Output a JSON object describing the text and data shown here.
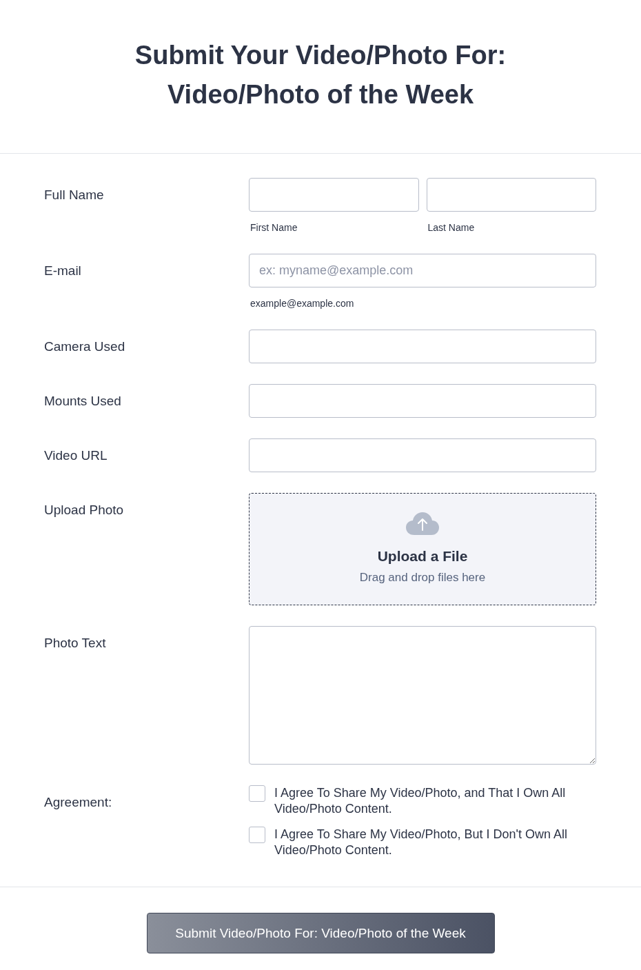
{
  "title": "Submit Your Video/Photo For: Video/Photo of the Week",
  "fields": [
    {
      "kind": "name",
      "label": "Full Name",
      "sublabels": [
        "First Name",
        "Last Name"
      ]
    },
    {
      "kind": "email",
      "label": "E-mail",
      "placeholder": "ex: myname@example.com",
      "sublabel": "example@example.com"
    },
    {
      "kind": "text",
      "label": "Camera Used"
    },
    {
      "kind": "text",
      "label": "Mounts Used"
    },
    {
      "kind": "text",
      "label": "Video URL"
    },
    {
      "kind": "upload",
      "label": "Upload Photo",
      "heading": "Upload a File",
      "hint": "Drag and drop files here"
    },
    {
      "kind": "textarea",
      "label": "Photo Text"
    },
    {
      "kind": "checkboxes",
      "label": "Agreement:",
      "options": [
        {
          "text": "I Agree To Share My Video/Photo, and That I Own All Video/Photo Content.",
          "checked": false
        },
        {
          "text": "I Agree To Share My Video/Photo, But I Don't Own All Video/Photo Content.",
          "checked": false
        }
      ]
    }
  ],
  "submit": "Submit Video/Photo For: Video/Photo of the Week"
}
